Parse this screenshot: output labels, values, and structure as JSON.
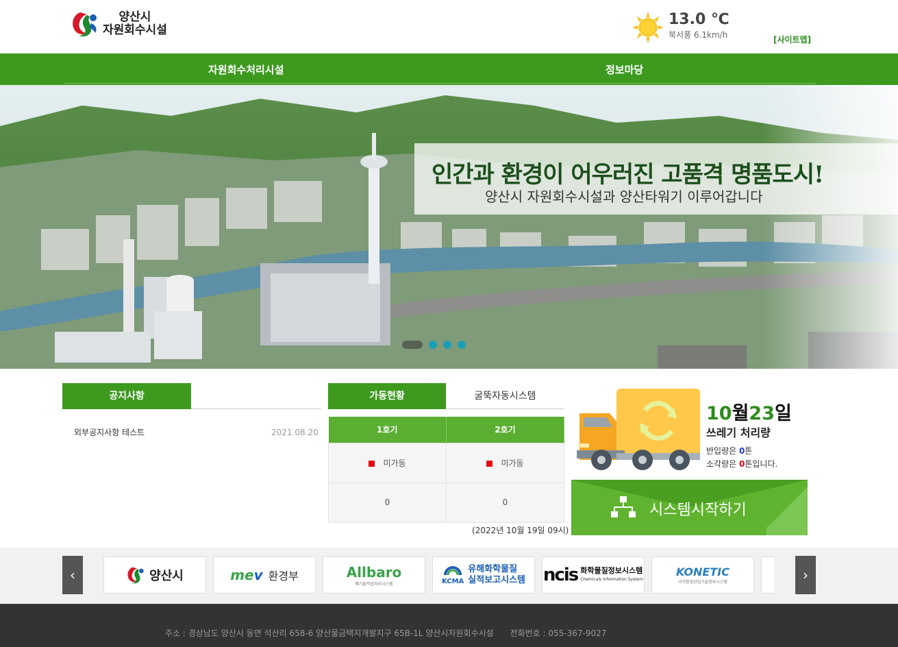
{
  "header": {
    "logo_line1": "양산시",
    "logo_line2": "자원회수시설",
    "temperature": "13.0 ℃",
    "wind": "북서풍 6.1km/h",
    "sitemap": "[사이트맵]"
  },
  "gnb": {
    "menu1": "자원회수처리시설",
    "menu2": "정보마당"
  },
  "hero": {
    "title": "인간과 환경이 어우러진 고품격 명품도시!",
    "subtitle": "양산시 자원회수시설과 양산타워기 이루어갑니다"
  },
  "notice": {
    "tab": "공지사항",
    "items": [
      {
        "title": "외부공지사항 테스트",
        "date": "2021.08.20"
      }
    ]
  },
  "operation": {
    "tab_active": "가동현황",
    "tab_other": "굴뚝자동시스템",
    "columns": [
      "1호기",
      "2호기"
    ],
    "status": [
      "미가동",
      "미가동"
    ],
    "values": [
      "0",
      "0"
    ],
    "timestamp": "(2022년 10월 19일 09시)"
  },
  "waste": {
    "month": "10",
    "month_unit": "월",
    "day": "23",
    "day_unit": "일",
    "title": "쓰레기 처리량",
    "incoming_prefix": "반입량은 ",
    "incoming_value": "0",
    "incoming_suffix": "톤",
    "burned_prefix": "소각량은 ",
    "burned_value": "0",
    "burned_suffix": "톤입니다."
  },
  "system_button": "시스템시작하기",
  "banners": {
    "prev": "‹",
    "next": "›",
    "items": [
      "양산시",
      "환경부",
      "Allbaro",
      "유해화학물질 실적보고시스템",
      "화학물질정보시스템",
      "KONETIC"
    ],
    "kcma_line1": "유해화학물질",
    "kcma_line2": "실적보고시스템",
    "ncis_line1": "화학물질정보시스템",
    "ncis_line2": "Chemicals Information System",
    "allbaro_sub": "폐기물적법처리시스템",
    "konetic_sub": "국가환경산업기술정보시스템"
  },
  "footer": {
    "address": "주소 : 경상남도 양산시 동면 석산리 658-6 양산물금택지개발지구 65B-1L 양산시자원회수시설",
    "phone": "전화번호 : 055-367-9027"
  },
  "colors": {
    "brand_green": "#3d9a1f",
    "light_green": "#5fb32f",
    "status_red": "#e60012",
    "value_blue": "#1a3bd6",
    "footer_bg": "#333333"
  }
}
